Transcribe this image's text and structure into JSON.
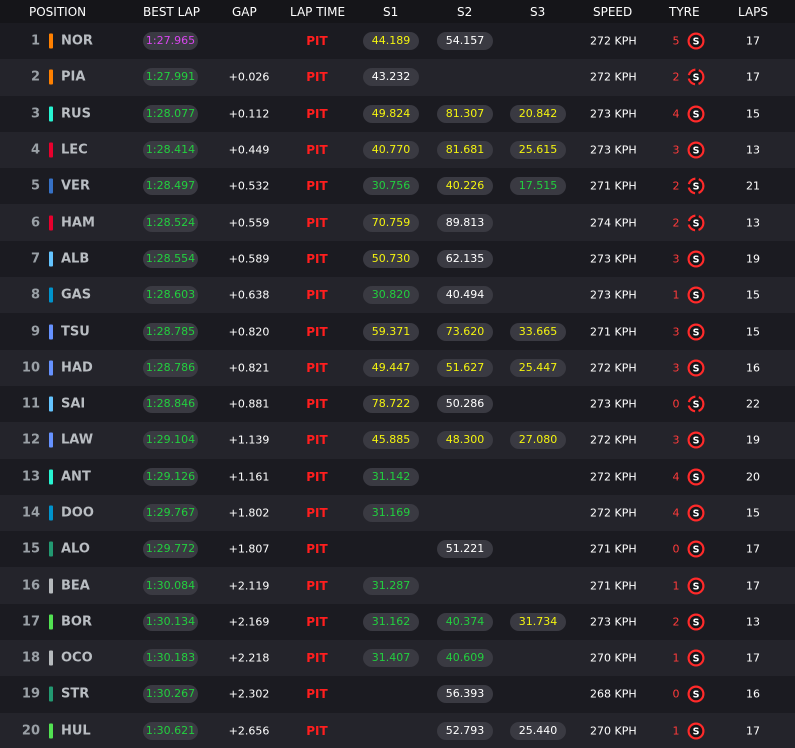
{
  "headers": {
    "position": "POSITION",
    "best_lap": "BEST LAP",
    "gap": "GAP",
    "lap_time": "LAP TIME",
    "s1": "S1",
    "s2": "S2",
    "s3": "S3",
    "speed": "SPEED",
    "tyre": "TYRE",
    "laps": "LAPS"
  },
  "colors": {
    "purple": "#d946ef",
    "green": "#22cf3e",
    "yellow": "#f4f40f",
    "pit_red": "#ff1e1e",
    "tyre_red": "#ff3b3b"
  },
  "rows": [
    {
      "position": "1",
      "team_color": "#ff8000",
      "driver": "NOR",
      "best_lap": "1:27.965",
      "best_color": "purple",
      "gap": "",
      "lap_time": "PIT",
      "s1": "44.189",
      "s1_color": "yellow",
      "s2": "54.157",
      "s2_color": "white",
      "s3": "",
      "s3_color": "",
      "speed": "272 KPH",
      "tyre_age": "5",
      "tyre_icon": "soft-tyre-icon",
      "laps": "17"
    },
    {
      "position": "2",
      "team_color": "#ff8000",
      "driver": "PIA",
      "best_lap": "1:27.991",
      "best_color": "green",
      "gap": "+0.026",
      "lap_time": "PIT",
      "s1": "43.232",
      "s1_color": "white",
      "s2": "",
      "s2_color": "",
      "s3": "",
      "s3_color": "",
      "speed": "272 KPH",
      "tyre_age": "2",
      "tyre_icon": "soft-tyre-used-icon",
      "laps": "17"
    },
    {
      "position": "3",
      "team_color": "#27f4d2",
      "driver": "RUS",
      "best_lap": "1:28.077",
      "best_color": "green",
      "gap": "+0.112",
      "lap_time": "PIT",
      "s1": "49.824",
      "s1_color": "yellow",
      "s2": "81.307",
      "s2_color": "yellow",
      "s3": "20.842",
      "s3_color": "yellow",
      "speed": "273 KPH",
      "tyre_age": "4",
      "tyre_icon": "soft-tyre-icon",
      "laps": "15"
    },
    {
      "position": "4",
      "team_color": "#e8002d",
      "driver": "LEC",
      "best_lap": "1:28.414",
      "best_color": "green",
      "gap": "+0.449",
      "lap_time": "PIT",
      "s1": "40.770",
      "s1_color": "yellow",
      "s2": "81.681",
      "s2_color": "yellow",
      "s3": "25.615",
      "s3_color": "yellow",
      "speed": "273 KPH",
      "tyre_age": "3",
      "tyre_icon": "soft-tyre-icon",
      "laps": "13"
    },
    {
      "position": "5",
      "team_color": "#3671c6",
      "driver": "VER",
      "best_lap": "1:28.497",
      "best_color": "green",
      "gap": "+0.532",
      "lap_time": "PIT",
      "s1": "30.756",
      "s1_color": "green",
      "s2": "40.226",
      "s2_color": "yellow",
      "s3": "17.515",
      "s3_color": "green",
      "speed": "271 KPH",
      "tyre_age": "2",
      "tyre_icon": "soft-tyre-used-icon",
      "laps": "21"
    },
    {
      "position": "6",
      "team_color": "#e8002d",
      "driver": "HAM",
      "best_lap": "1:28.524",
      "best_color": "green",
      "gap": "+0.559",
      "lap_time": "PIT",
      "s1": "70.759",
      "s1_color": "yellow",
      "s2": "89.813",
      "s2_color": "white",
      "s3": "",
      "s3_color": "",
      "speed": "274 KPH",
      "tyre_age": "2",
      "tyre_icon": "soft-tyre-used-icon",
      "laps": "13"
    },
    {
      "position": "7",
      "team_color": "#64c4ff",
      "driver": "ALB",
      "best_lap": "1:28.554",
      "best_color": "green",
      "gap": "+0.589",
      "lap_time": "PIT",
      "s1": "50.730",
      "s1_color": "yellow",
      "s2": "62.135",
      "s2_color": "white",
      "s3": "",
      "s3_color": "",
      "speed": "273 KPH",
      "tyre_age": "3",
      "tyre_icon": "soft-tyre-icon",
      "laps": "19"
    },
    {
      "position": "8",
      "team_color": "#0093cc",
      "driver": "GAS",
      "best_lap": "1:28.603",
      "best_color": "green",
      "gap": "+0.638",
      "lap_time": "PIT",
      "s1": "30.820",
      "s1_color": "green",
      "s2": "40.494",
      "s2_color": "white",
      "s3": "",
      "s3_color": "",
      "speed": "273 KPH",
      "tyre_age": "1",
      "tyre_icon": "soft-tyre-icon",
      "laps": "15"
    },
    {
      "position": "9",
      "team_color": "#6692ff",
      "driver": "TSU",
      "best_lap": "1:28.785",
      "best_color": "green",
      "gap": "+0.820",
      "lap_time": "PIT",
      "s1": "59.371",
      "s1_color": "yellow",
      "s2": "73.620",
      "s2_color": "yellow",
      "s3": "33.665",
      "s3_color": "yellow",
      "speed": "271 KPH",
      "tyre_age": "3",
      "tyre_icon": "soft-tyre-icon",
      "laps": "15"
    },
    {
      "position": "10",
      "team_color": "#6692ff",
      "driver": "HAD",
      "best_lap": "1:28.786",
      "best_color": "green",
      "gap": "+0.821",
      "lap_time": "PIT",
      "s1": "49.447",
      "s1_color": "yellow",
      "s2": "51.627",
      "s2_color": "yellow",
      "s3": "25.447",
      "s3_color": "yellow",
      "speed": "272 KPH",
      "tyre_age": "3",
      "tyre_icon": "soft-tyre-icon",
      "laps": "16"
    },
    {
      "position": "11",
      "team_color": "#64c4ff",
      "driver": "SAI",
      "best_lap": "1:28.846",
      "best_color": "green",
      "gap": "+0.881",
      "lap_time": "PIT",
      "s1": "78.722",
      "s1_color": "yellow",
      "s2": "50.286",
      "s2_color": "white",
      "s3": "",
      "s3_color": "",
      "speed": "273 KPH",
      "tyre_age": "0",
      "tyre_icon": "soft-tyre-used-icon",
      "laps": "22"
    },
    {
      "position": "12",
      "team_color": "#6692ff",
      "driver": "LAW",
      "best_lap": "1:29.104",
      "best_color": "green",
      "gap": "+1.139",
      "lap_time": "PIT",
      "s1": "45.885",
      "s1_color": "yellow",
      "s2": "48.300",
      "s2_color": "yellow",
      "s3": "27.080",
      "s3_color": "yellow",
      "speed": "272 KPH",
      "tyre_age": "3",
      "tyre_icon": "soft-tyre-icon",
      "laps": "19"
    },
    {
      "position": "13",
      "team_color": "#27f4d2",
      "driver": "ANT",
      "best_lap": "1:29.126",
      "best_color": "green",
      "gap": "+1.161",
      "lap_time": "PIT",
      "s1": "31.142",
      "s1_color": "green",
      "s2": "",
      "s2_color": "",
      "s3": "",
      "s3_color": "",
      "speed": "272 KPH",
      "tyre_age": "4",
      "tyre_icon": "soft-tyre-icon",
      "laps": "20"
    },
    {
      "position": "14",
      "team_color": "#0093cc",
      "driver": "DOO",
      "best_lap": "1:29.767",
      "best_color": "green",
      "gap": "+1.802",
      "lap_time": "PIT",
      "s1": "31.169",
      "s1_color": "green",
      "s2": "",
      "s2_color": "",
      "s3": "",
      "s3_color": "",
      "speed": "272 KPH",
      "tyre_age": "4",
      "tyre_icon": "soft-tyre-icon",
      "laps": "15"
    },
    {
      "position": "15",
      "team_color": "#229971",
      "driver": "ALO",
      "best_lap": "1:29.772",
      "best_color": "green",
      "gap": "+1.807",
      "lap_time": "PIT",
      "s1": "",
      "s1_color": "",
      "s2": "51.221",
      "s2_color": "white",
      "s3": "",
      "s3_color": "",
      "speed": "271 KPH",
      "tyre_age": "0",
      "tyre_icon": "soft-tyre-icon",
      "laps": "17"
    },
    {
      "position": "16",
      "team_color": "#b6babd",
      "driver": "BEA",
      "best_lap": "1:30.084",
      "best_color": "green",
      "gap": "+2.119",
      "lap_time": "PIT",
      "s1": "31.287",
      "s1_color": "green",
      "s2": "",
      "s2_color": "",
      "s3": "",
      "s3_color": "",
      "speed": "271 KPH",
      "tyre_age": "1",
      "tyre_icon": "soft-tyre-icon",
      "laps": "17"
    },
    {
      "position": "17",
      "team_color": "#52e252",
      "driver": "BOR",
      "best_lap": "1:30.134",
      "best_color": "green",
      "gap": "+2.169",
      "lap_time": "PIT",
      "s1": "31.162",
      "s1_color": "green",
      "s2": "40.374",
      "s2_color": "green",
      "s3": "31.734",
      "s3_color": "yellow",
      "speed": "273 KPH",
      "tyre_age": "2",
      "tyre_icon": "soft-tyre-icon",
      "laps": "13"
    },
    {
      "position": "18",
      "team_color": "#b6babd",
      "driver": "OCO",
      "best_lap": "1:30.183",
      "best_color": "green",
      "gap": "+2.218",
      "lap_time": "PIT",
      "s1": "31.407",
      "s1_color": "green",
      "s2": "40.609",
      "s2_color": "green",
      "s3": "",
      "s3_color": "",
      "speed": "270 KPH",
      "tyre_age": "1",
      "tyre_icon": "soft-tyre-icon",
      "laps": "17"
    },
    {
      "position": "19",
      "team_color": "#229971",
      "driver": "STR",
      "best_lap": "1:30.267",
      "best_color": "green",
      "gap": "+2.302",
      "lap_time": "PIT",
      "s1": "",
      "s1_color": "",
      "s2": "56.393",
      "s2_color": "white",
      "s3": "",
      "s3_color": "",
      "speed": "268 KPH",
      "tyre_age": "0",
      "tyre_icon": "soft-tyre-icon",
      "laps": "16"
    },
    {
      "position": "20",
      "team_color": "#52e252",
      "driver": "HUL",
      "best_lap": "1:30.621",
      "best_color": "green",
      "gap": "+2.656",
      "lap_time": "PIT",
      "s1": "",
      "s1_color": "",
      "s2": "52.793",
      "s2_color": "white",
      "s3": "25.440",
      "s3_color": "white",
      "speed": "270 KPH",
      "tyre_age": "1",
      "tyre_icon": "soft-tyre-icon",
      "laps": "17"
    }
  ]
}
